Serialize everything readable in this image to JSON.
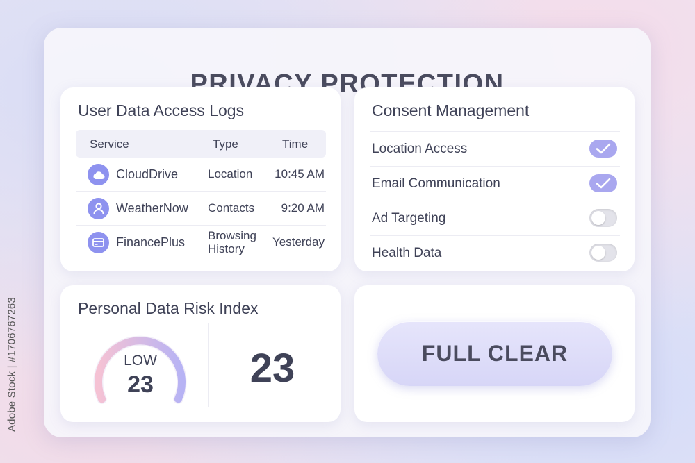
{
  "page": {
    "title": "PRIVACY PROTECTION"
  },
  "watermark": {
    "side_text": "Adobe Stock | #1706767263"
  },
  "access_logs": {
    "title": "User Data Access Logs",
    "columns": [
      "Service",
      "Type",
      "Time"
    ],
    "rows": [
      {
        "icon": "cloud-icon",
        "service": "CloudDrive",
        "type": "Location",
        "time": "10:45 AM"
      },
      {
        "icon": "user-icon",
        "service": "WeatherNow",
        "type": "Contacts",
        "time": "9:20 AM"
      },
      {
        "icon": "card-icon",
        "service": "FinancePlus",
        "type": "Browsing History",
        "time": "Yesterday"
      }
    ]
  },
  "consent": {
    "title": "Consent Management",
    "items": [
      {
        "label": "Location Access",
        "enabled": true
      },
      {
        "label": "Email Communication",
        "enabled": true
      },
      {
        "label": "Ad Targeting",
        "enabled": false
      },
      {
        "label": "Health Data",
        "enabled": false
      }
    ]
  },
  "risk": {
    "title": "Personal Data Risk Index",
    "level": "LOW",
    "value": "23",
    "big_value": "23"
  },
  "actions": {
    "full_clear_label": "FULL CLEAR"
  },
  "colors": {
    "accent": "#8e92ef",
    "toggle_on": "#a9a7ef",
    "gauge_start": "#f5c2d4",
    "gauge_end": "#b7b3f4",
    "text": "#3f4257"
  }
}
